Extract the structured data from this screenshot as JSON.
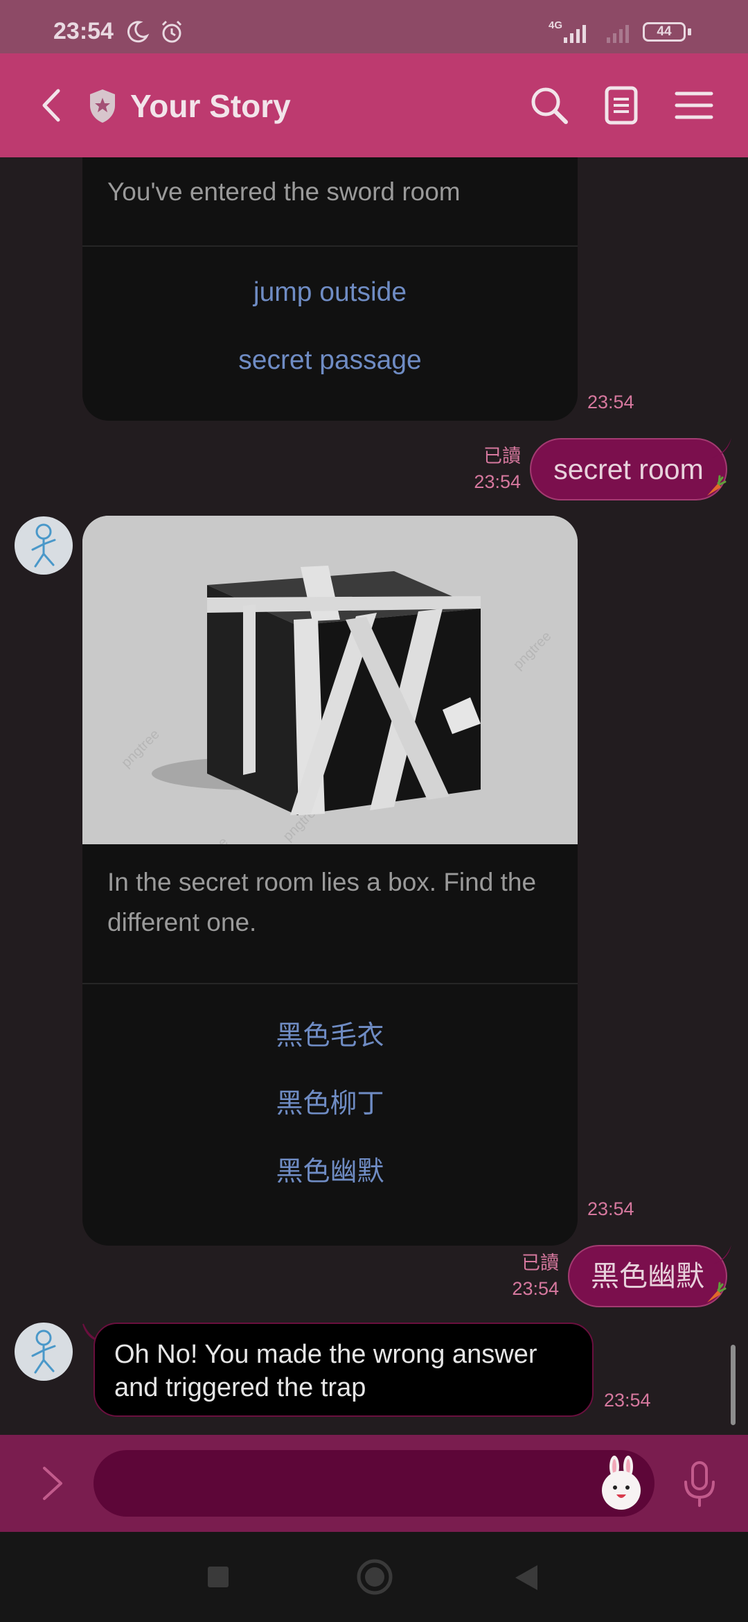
{
  "status_bar": {
    "time": "23:54",
    "network": "4G",
    "battery": "44",
    "icons": [
      "moon-icon",
      "alarm-icon",
      "signal-icon",
      "signal-icon",
      "battery-icon"
    ]
  },
  "header": {
    "title": "Your Story",
    "icons": [
      "back-icon",
      "shield-star-icon",
      "search-icon",
      "notes-icon",
      "menu-icon"
    ]
  },
  "chat": {
    "card1": {
      "text": "You've entered the sword room",
      "options": [
        "jump outside",
        "secret passage"
      ],
      "time": "23:54"
    },
    "out1": {
      "read": "已讀",
      "time": "23:54",
      "text": "secret room"
    },
    "card2": {
      "text": "In the secret room lies a box. Find the different one.",
      "options": [
        "黑色毛衣",
        "黑色柳丁",
        "黑色幽默"
      ],
      "time": "23:54"
    },
    "out2": {
      "read": "已讀",
      "time": "23:54",
      "text": "黑色幽默"
    },
    "in1": {
      "text": "Oh No! You made the wrong answer and triggered the trap",
      "time": "23:54"
    }
  },
  "input": {
    "placeholder": "",
    "value": ""
  },
  "colors": {
    "header": "#bd3a6f",
    "status_bar": "#8d4a66",
    "background": "#221c1f",
    "bubble_out": "#7b0f4d",
    "option_link": "#6f8cc4",
    "timestamp": "#d6789e"
  }
}
